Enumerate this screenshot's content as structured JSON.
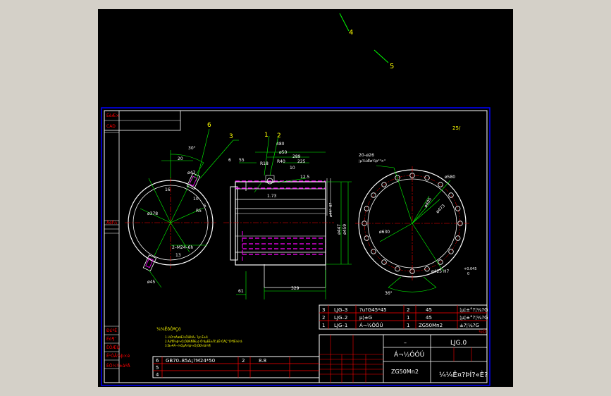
{
  "colors": {
    "background": "#000000",
    "frame": "#0000ff",
    "outline": "#ffffff",
    "dimension": "#00ff00",
    "center": "#ff0000",
    "hidden": "#ff00ff",
    "text_yellow": "#ffff00",
    "table_red": "#ff0000"
  },
  "balloons": {
    "top_4": "4",
    "top_5": "5",
    "left_6": "6",
    "left_3": "3",
    "mid_1": "1",
    "mid_2": "2"
  },
  "left_view": {
    "angle_30": "30°",
    "dim_20": "20",
    "dim_47": "ø47",
    "dim_r5": "R5",
    "dim_378": "ø378",
    "dim_10": "10",
    "dim_5": "5",
    "thread": "2–M24–6h",
    "dim_13": "13",
    "dim_16": "16",
    "dim_45": "ø45"
  },
  "section_view": {
    "dim_480": "480",
    "dim_50": "ø50",
    "dim_289": "289",
    "dim_225": "225",
    "dim_r18": "R18",
    "dim_r40": "R40",
    "dim_6": "6",
    "dim_55": "55",
    "dim_10": "10",
    "dim_125": "12.5",
    "dim_173": "1.73",
    "dim_447": "ø447",
    "dim_459": "ø459",
    "dim_61": "61",
    "dim_329": "329",
    "vert_label": "ø44° H7"
  },
  "right_view": {
    "holes": "20–ø26",
    "holes_note": "¦µ¾ùÊø¼þ°²×°",
    "dim_580": "ø580",
    "dim_405": "ø405",
    "dim_473": "ø473",
    "dim_630": "ø630",
    "dim_bore": "ø425 H7",
    "tol_upper": "+0.045",
    "tol_lower": "0",
    "angle_36": "36°"
  },
  "corner_mark": "25/",
  "notes": {
    "title": "¼¼ÊõÒªÇó",
    "line1": "1.¼Ó¹¤ÃæÆ½ÕûÎÞÃ«´Ì¡¢·É±ß",
    "line2": "2.Ä£¶Í¼þ²»Ó¦ÓÐÁÑÎÆ¡¢·Ö²ãµÈÈ±ÏÝ¡£Ê¹ÓÃÇ°Ó²¶È¼ì²â",
    "line3": "3.Ïà»¥Á¬½ÓµÄ¼þ²»Ó¦ÓÐ¼ä¼¶"
  },
  "left_strip": [
    "ÉèÆ×",
    "CAD",
    "ÃèÍ¼",
    "Ð£ºË",
    "Éó¶¨",
    "ÈÕÆÚ",
    "Ê¹ÓÃ¼þ×é",
    "ÈÕ¾Ý±àºÅ"
  ],
  "parts_table": [
    {
      "no": "3",
      "code": "LJG–3",
      "name": "?u?G45*45",
      "qty": "2",
      "material": "45",
      "note": "¦µ¦±°?¦¼?G"
    },
    {
      "no": "2",
      "code": "LJG–2",
      "name": "µ¦±G",
      "qty": "1",
      "material": "45",
      "note": "¦µ¦±°?¦¼?G"
    },
    {
      "no": "1",
      "code": "LJG–1",
      "name": "Á¬½ÓÓÚ",
      "qty": "1",
      "material": "ZG50Mn2",
      "note": "±?¦¼?G"
    }
  ],
  "bottom_table": [
    {
      "no": "6",
      "code": "GB70–85A¡?M24*50",
      "qty": "2",
      "material": "8.8"
    },
    {
      "no": "5",
      "code": "",
      "qty": "",
      "material": ""
    },
    {
      "no": "4",
      "code": "",
      "qty": "",
      "material": ""
    }
  ],
  "title_block": {
    "code": "LJG.0",
    "dash": "–",
    "part_name": "Á¬½ÓÓÚ",
    "material": "ZG50Mn2",
    "company": "¼¼Ê¤?ÞÍ?«È?",
    "tag": "½Ö"
  }
}
